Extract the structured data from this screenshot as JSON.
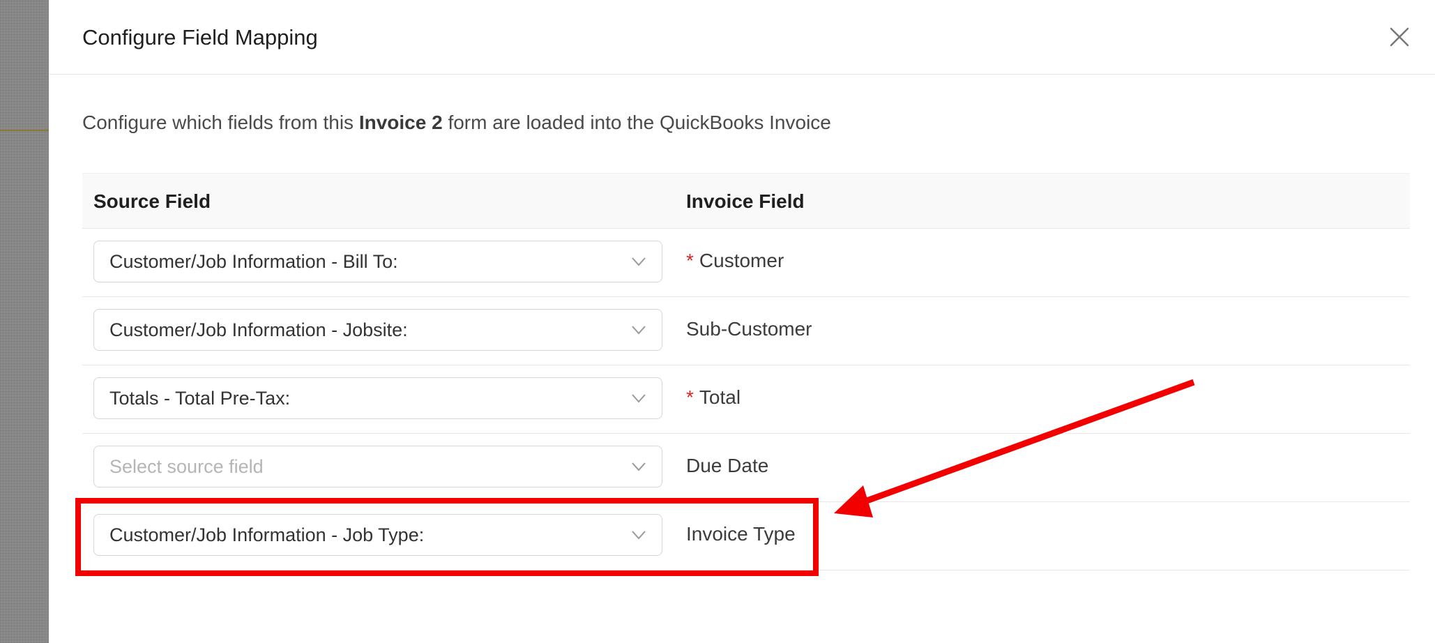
{
  "modal": {
    "title": "Configure Field Mapping",
    "description": {
      "prefix": "Configure which fields from this ",
      "form_name": "Invoice 2",
      "suffix": " form are loaded into the QuickBooks Invoice"
    }
  },
  "table": {
    "headers": {
      "source": "Source Field",
      "invoice": "Invoice Field"
    },
    "rows": [
      {
        "source_value": "Customer/Job Information - Bill To:",
        "placeholder": false,
        "invoice_field": "Customer",
        "required": true
      },
      {
        "source_value": "Customer/Job Information - Jobsite:",
        "placeholder": false,
        "invoice_field": "Sub-Customer",
        "required": false
      },
      {
        "source_value": "Totals - Total Pre-Tax:",
        "placeholder": false,
        "invoice_field": "Total",
        "required": true
      },
      {
        "source_value": "Select source field",
        "placeholder": true,
        "invoice_field": "Due Date",
        "required": false
      },
      {
        "source_value": "Customer/Job Information - Job Type:",
        "placeholder": false,
        "invoice_field": "Invoice Type",
        "required": false
      }
    ],
    "required_marker": "*"
  },
  "icons": {
    "close": "close-icon",
    "dropdown": "chevron-down-icon"
  },
  "colors": {
    "required": "#e02424",
    "annotation": "#f20000"
  }
}
